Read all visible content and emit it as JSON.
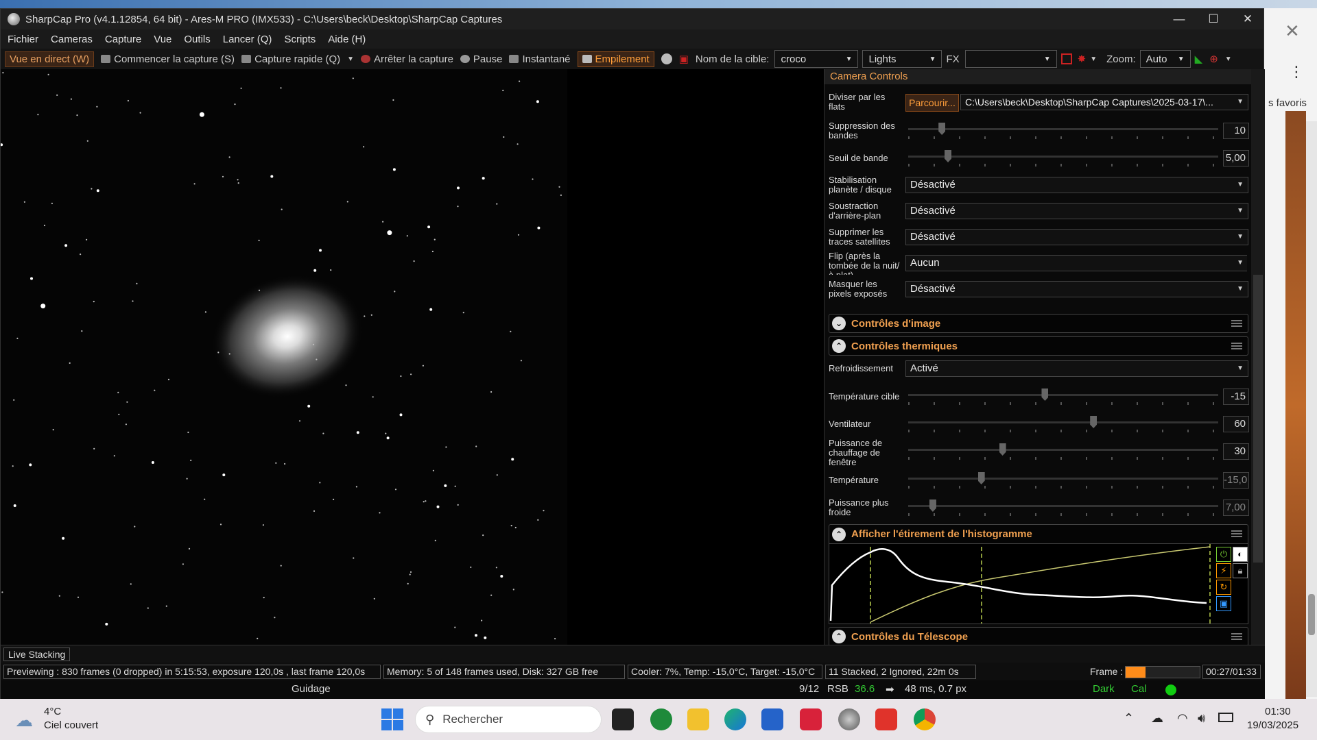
{
  "window": {
    "title": "SharpCap Pro (v4.1.12854, 64 bit) - Ares-M PRO (IMX533) - C:\\Users\\beck\\Desktop\\SharpCap Captures",
    "minimize_icon": "minimize-icon",
    "maximize_icon": "maximize-icon",
    "close_icon": "close-icon"
  },
  "menu": [
    "Fichier",
    "Cameras",
    "Capture",
    "Vue",
    "Outils",
    "Lancer (Q)",
    "Scripts",
    "Aide (H)"
  ],
  "toolbar": {
    "live_view": "Vue en direct (W)",
    "start_capture": "Commencer la capture (S)",
    "quick_capture": "Capture rapide (Q)",
    "stop_capture": "Arrêter la capture",
    "pause": "Pause",
    "snapshot": "Instantané",
    "stacking": "Empilement",
    "target_label": "Nom de la cible:",
    "target_value": "croco",
    "frame_type": "Lights",
    "fx_label": "FX",
    "fx_value": "",
    "zoom_label": "Zoom:",
    "zoom_value": "Auto"
  },
  "panel": {
    "title": "Camera Controls",
    "flats_label": "Diviser par les flats",
    "flats_button": "Parcourir...",
    "flats_path": "C:\\Users\\beck\\Desktop\\SharpCap Captures\\2025-03-17\\...",
    "banding_label": "Suppression des bandes",
    "banding_value": "10",
    "banding_level": 0.1,
    "band_threshold_label": "Seuil de bande",
    "band_threshold_value": "5,00",
    "band_threshold_level": 0.12,
    "stabilization_label": "Stabilisation planète / disque",
    "stabilization_value": "Désactivé",
    "background_label": "Soustraction d'arrière-plan",
    "background_value": "Désactivé",
    "satellite_label": "Supprimer les traces satellites",
    "satellite_value": "Désactivé",
    "flip_label": "Flip (après la tombée de la nuit/à plat)",
    "flip_value": "Aucun",
    "hotpixel_label": "Masquer les pixels exposés",
    "hotpixel_value": "Désactivé",
    "image_controls": "Contrôles d'image",
    "thermal_controls": "Contrôles thermiques",
    "cooling_label": "Refroidissement",
    "cooling_value": "Activé",
    "target_temp_label": "Température cible",
    "target_temp_value": "-15",
    "target_temp_level": 0.44,
    "fan_label": "Ventilateur",
    "fan_value": "60",
    "fan_level": 0.6,
    "heater_label": "Puissance de chauffage de fenêtre",
    "heater_value": "30",
    "heater_level": 0.3,
    "temp_label": "Température",
    "temp_value": "-15,0",
    "temp_level": 0.23,
    "cooler_power_label": "Puissance plus froide",
    "cooler_power_value": "7,00",
    "cooler_power_level": 0.07,
    "histogram_title": "Afficher l'étirement de l'histogramme",
    "telescope_controls": "Contrôles du Télescope"
  },
  "live_stacking": "Live Stacking",
  "status": {
    "preview": "Previewing : 830 frames (0 dropped) in 5:15:53, exposure 120,0s , last frame 120,0s",
    "memory": "Memory: 5 of 148 frames used, Disk: 327 GB free",
    "cooler": "Cooler: 7%, Temp: -15,0°C, Target: -15,0°C",
    "stacked": "11 Stacked, 2 Ignored, 22m 0s",
    "frame_label": "Frame :",
    "frame_progress": 0.27,
    "frame_time": "00:27/01:33"
  },
  "guide": {
    "label": "Guidage",
    "count": "9/12",
    "rsb_label": "RSB",
    "rsb_value": "36.6",
    "timing": "48 ms, 0.7 px",
    "dark": "Dark",
    "cal": "Cal"
  },
  "taskbar": {
    "temperature": "4°C",
    "weather": "Ciel couvert",
    "search_placeholder": "Rechercher",
    "time": "01:30",
    "date": "19/03/2025"
  },
  "browser": {
    "favorites_text": "s favoris"
  }
}
